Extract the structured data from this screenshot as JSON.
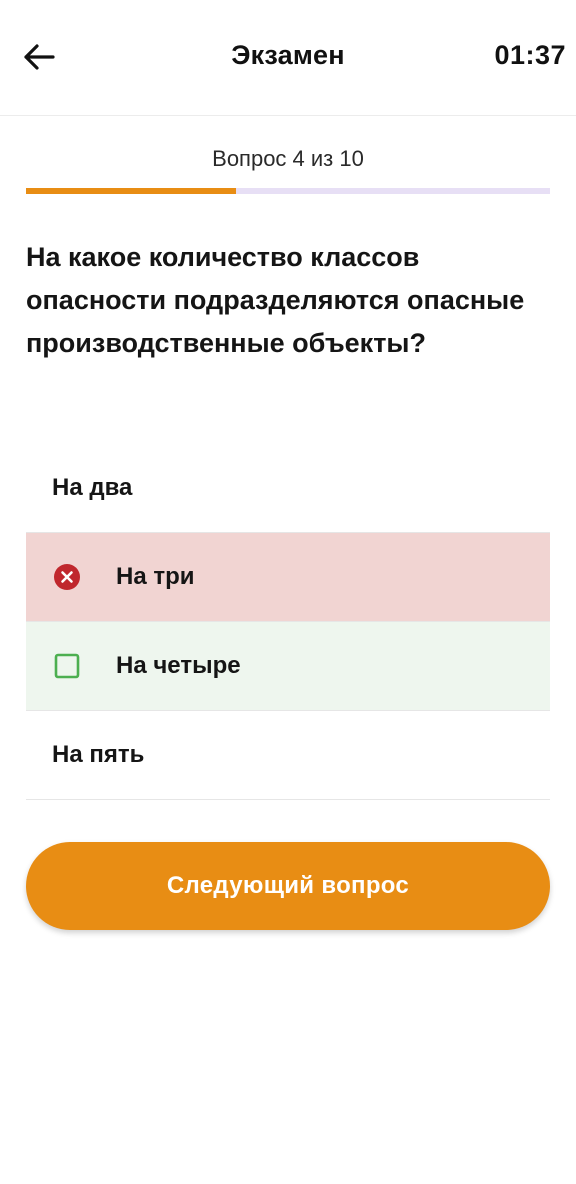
{
  "header": {
    "title": "Экзамен",
    "timer": "01:37",
    "back_icon": "arrow-left-icon"
  },
  "progress": {
    "text": "Вопрос 4 из 10",
    "current": 4,
    "total": 10,
    "fraction": 0.4,
    "fill_color": "#e88d14",
    "track_color": "#e7dff5"
  },
  "question": {
    "text": "На какое количество классов опасности подразделяются опасные производственные объекты?"
  },
  "answers": [
    {
      "label": "На два",
      "state": "neutral"
    },
    {
      "label": "На три",
      "state": "wrong",
      "icon": "x-circle-icon",
      "bg_color": "#f1d4d2",
      "icon_color": "#c0272d"
    },
    {
      "label": "На четыре",
      "state": "correct",
      "icon": "checkbox-icon",
      "bg_color": "#eef6ee",
      "icon_color": "#4caf50"
    },
    {
      "label": "На пять",
      "state": "neutral"
    }
  ],
  "next_button": {
    "label": "Следующий вопрос",
    "color": "#e88d14"
  }
}
